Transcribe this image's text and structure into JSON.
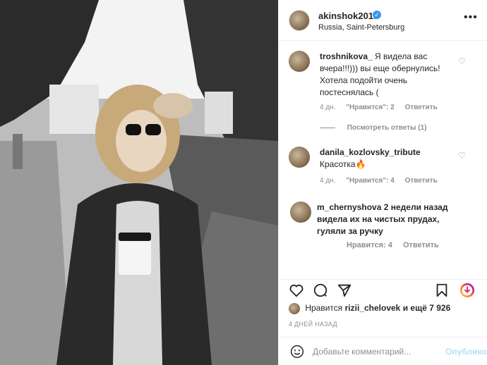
{
  "post": {
    "username": "akinshok2013",
    "verified_badge": "✓",
    "location": "Russia, Saint-Petersburg",
    "more_icon": "more-horizontal-icon"
  },
  "comments": [
    {
      "user": "troshnikova_",
      "text": "Я видела вас вчера!!!))) вы еще обернулись! Хотела подойти очень постеснялась (",
      "time": "4 дн.",
      "likes": "\"Нравится\": 2",
      "reply": "Ответить"
    },
    {
      "user": "danila_kozlovsky_tribute",
      "text": "Красотка🔥",
      "time": "4 дн.",
      "likes": "\"Нравится\": 4",
      "reply": "Ответить"
    },
    {
      "user": "m_chernyshova",
      "time": "2 недели назад",
      "text": "видела их на чистых прудах, гуляли за ручку",
      "likes": "Нравится: 4",
      "reply": "Ответить"
    }
  ],
  "view_replies": "Посмотреть ответы (1)",
  "likes": {
    "prefix": "Нравится",
    "user": "rizii_chelovek",
    "suffix": "и ещё 7 926"
  },
  "date": "4 ДНЕЙ НАЗАД",
  "add_comment": {
    "placeholder": "Добавьте комментарий...",
    "publish": "Опубликовать"
  },
  "colors": {
    "accent_blue": "#3897f0",
    "muted": "#8e8e8e"
  }
}
